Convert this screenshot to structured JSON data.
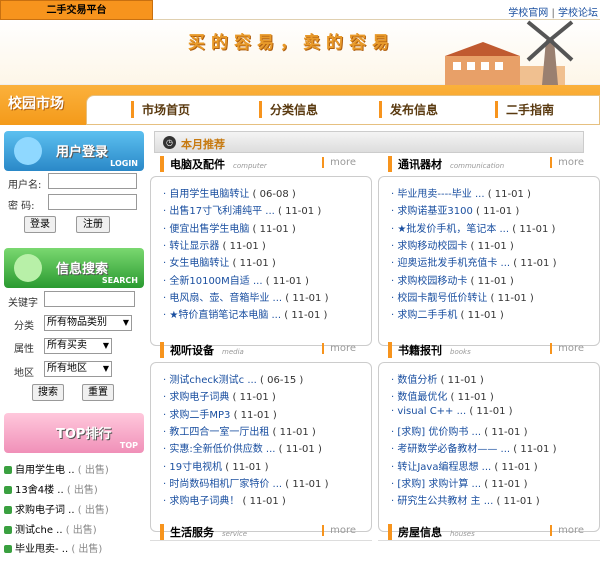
{
  "header": {
    "site_tab": "二手交易平台",
    "link_school_site": "学校官网",
    "sep": " | ",
    "link_school_forum": "学校论坛"
  },
  "banner": {
    "slogan": "买的容易，卖的容易"
  },
  "nav": {
    "logo": "校园市场",
    "items": [
      "市场首页",
      "分类信息",
      "发布信息",
      "二手指南"
    ]
  },
  "login": {
    "title": "用户登录",
    "subtitle": "LOGIN",
    "username_label": "用户名:",
    "password_label": "密  码:",
    "login_button": "登录",
    "register_button": "注册"
  },
  "search": {
    "title": "信息搜索",
    "subtitle": "SEARCH",
    "keyword_label": "关键字",
    "category_label": "分类",
    "category_value": "所有物品类别",
    "attribute_label": "属性",
    "attribute_value": "所有买卖",
    "region_label": "地区",
    "region_value": "所有地区",
    "search_button": "搜索",
    "reset_button": "重置"
  },
  "top": {
    "title": "TOP排行",
    "subtitle": "TOP",
    "items": [
      {
        "name": "自用学生电 ..",
        "tag": "( 出售)"
      },
      {
        "name": "13舍4楼 ..",
        "tag": "( 出售)"
      },
      {
        "name": "求购电子词 ..",
        "tag": "( 出售)"
      },
      {
        "name": "测试che ..",
        "tag": "( 出售)"
      },
      {
        "name": "毕业甩卖- ..",
        "tag": "( 出售)"
      }
    ]
  },
  "main": {
    "title": "本月推荐",
    "more": "more",
    "panels": [
      {
        "title": "电脑及配件",
        "en": "computer",
        "rows": [
          {
            "t": "自用学生电脑转让",
            "d": "( 06-08 )"
          },
          {
            "t": "出售17寸飞利浦纯平 ...",
            "d": "( 11-01 )"
          },
          {
            "t": "便宜出售学生电脑",
            "d": "( 11-01 )"
          },
          {
            "t": "转让显示器",
            "d": "( 11-01 )"
          },
          {
            "t": "女生电脑转让",
            "d": "( 11-01 )"
          },
          {
            "t": "全新10100M自适 ...",
            "d": "( 11-01 )"
          },
          {
            "t": "电风扇、壶、音箱毕业 ...",
            "d": "( 11-01 )"
          },
          {
            "t": "★特价直销笔记本电脑 ...",
            "d": "( 11-01 )"
          }
        ]
      },
      {
        "title": "通讯器材",
        "en": "communication",
        "rows": [
          {
            "t": "毕业甩卖----毕业 ...",
            "d": "( 11-01 )"
          },
          {
            "t": "求购诺基亚3100",
            "d": "( 11-01 )"
          },
          {
            "t": "★批发价手机，笔记本 ...",
            "d": "( 11-01 )"
          },
          {
            "t": "求购移动校园卡",
            "d": "( 11-01 )"
          },
          {
            "t": "迎奥运批发手机充值卡 ...",
            "d": "( 11-01 )"
          },
          {
            "t": "求购校园移动卡",
            "d": "( 11-01 )"
          },
          {
            "t": "校园卡靓号低价转让",
            "d": "( 11-01 )"
          },
          {
            "t": "求购二手手机",
            "d": "( 11-01 )"
          }
        ]
      },
      {
        "title": "视听设备",
        "en": "media",
        "rows": [
          {
            "t": "测试check测试c ...",
            "d": "( 06-15 )"
          },
          {
            "t": "求购电子词典",
            "d": "( 11-01 )"
          },
          {
            "t": "求购二手MP3",
            "d": "( 11-01 )"
          },
          {
            "t": "教工四合一室一厅出租",
            "d": "( 11-01 )"
          },
          {
            "t": "实惠:全新低价供应数 ...",
            "d": "( 11-01 )"
          },
          {
            "t": "19寸电视机",
            "d": "( 11-01 )"
          },
          {
            "t": "时尚数码相机厂家特价 ...",
            "d": "( 11-01 )"
          },
          {
            "t": "求购电子词典！",
            "d": "( 11-01 )"
          }
        ]
      },
      {
        "title": "书籍报刊",
        "en": "books",
        "rows": [
          {
            "t": "数值分析",
            "d": "( 11-01 )"
          },
          {
            "t": "数值最优化",
            "d": "( 11-01 )"
          },
          {
            "t": "visual C++ ...",
            "d": "( 11-01 )"
          },
          {
            "t": "[求购] 优价购书 ...",
            "d": "( 11-01 )"
          },
          {
            "t": "考研数学必备教材—— ...",
            "d": "( 11-01 )"
          },
          {
            "t": "转让Java编程思想 ...",
            "d": "( 11-01 )"
          },
          {
            "t": "[求购] 求购计算 ...",
            "d": "( 11-01 )"
          },
          {
            "t": "研究生公共教材 主 ...",
            "d": "( 11-01 )"
          }
        ]
      },
      {
        "title": "生活服务",
        "en": "service",
        "rows": []
      },
      {
        "title": "房屋信息",
        "en": "houses",
        "rows": []
      }
    ]
  },
  "colors": {
    "accent": "#f7941d",
    "link": "#1a4fa0",
    "login_head": "#3aa0e0",
    "search_head": "#40b040",
    "top_head": "#e87aa0"
  }
}
